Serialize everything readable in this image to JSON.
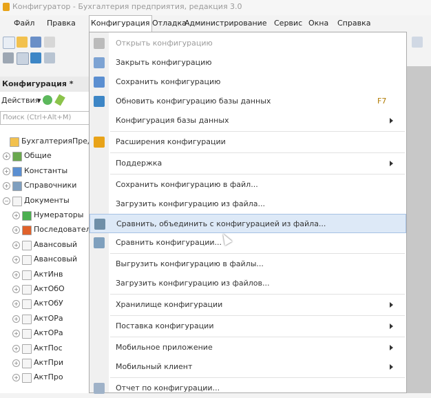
{
  "window": {
    "title": "Конфигуратор - Бухгалтерия предприятия, редакция 3.0"
  },
  "menubar": [
    {
      "label": "Файл",
      "active": false
    },
    {
      "label": "Правка",
      "active": false
    },
    {
      "label": "Конфигурация",
      "active": true
    },
    {
      "label": "Отладка",
      "active": false
    },
    {
      "label": "Администрирование",
      "active": false
    },
    {
      "label": "Сервис",
      "active": false
    },
    {
      "label": "Окна",
      "active": false
    },
    {
      "label": "Справка",
      "active": false
    }
  ],
  "panel": {
    "title": "Конфигурация *",
    "actions_label": "Действия",
    "search_placeholder": "Поиск (Ctrl+Alt+M)",
    "tree": [
      {
        "label": "БухгалтерияПредприятия",
        "level": 0,
        "icon": "root-icon"
      },
      {
        "label": "Общие",
        "level": 1,
        "icon": "common-icon"
      },
      {
        "label": "Константы",
        "level": 1,
        "icon": "constants-icon"
      },
      {
        "label": "Справочники",
        "level": 1,
        "icon": "catalog-icon"
      },
      {
        "label": "Документы",
        "level": 1,
        "icon": "document-icon"
      },
      {
        "label": "Нумераторы",
        "level": 2,
        "icon": "numerator-icon"
      },
      {
        "label": "Последовательности",
        "level": 2,
        "icon": "sequence-icon"
      },
      {
        "label": "Авансовый",
        "level": 2,
        "icon": "document-icon"
      },
      {
        "label": "Авансовый",
        "level": 2,
        "icon": "document-icon"
      },
      {
        "label": "АктИнв",
        "level": 2,
        "icon": "document-icon"
      },
      {
        "label": "АктОбО",
        "level": 2,
        "icon": "document-icon"
      },
      {
        "label": "АктОбУ",
        "level": 2,
        "icon": "document-icon"
      },
      {
        "label": "АктОРа",
        "level": 2,
        "icon": "document-icon"
      },
      {
        "label": "АктОРа",
        "level": 2,
        "icon": "document-icon"
      },
      {
        "label": "АктПос",
        "level": 2,
        "icon": "document-icon"
      },
      {
        "label": "АктПри",
        "level": 2,
        "icon": "document-icon"
      },
      {
        "label": "АктПро",
        "level": 2,
        "icon": "document-icon"
      }
    ]
  },
  "menu": {
    "items": [
      {
        "label": "Открыть конфигурацию",
        "shortcut": "",
        "submenu": false,
        "disabled": true,
        "icon": "open-config-icon"
      },
      {
        "label": "Закрыть конфигурацию",
        "shortcut": "",
        "submenu": false,
        "disabled": false,
        "icon": "close-config-icon"
      },
      {
        "label": "Сохранить конфигурацию",
        "shortcut": "",
        "submenu": false,
        "disabled": false,
        "icon": "save-config-icon"
      },
      {
        "label": "Обновить конфигурацию базы данных",
        "shortcut": "F7",
        "submenu": false,
        "disabled": false,
        "icon": "update-db-icon"
      },
      {
        "label": "Конфигурация базы данных",
        "shortcut": "",
        "submenu": true,
        "disabled": false,
        "icon": ""
      },
      {
        "separator": true
      },
      {
        "label": "Расширения конфигурации",
        "shortcut": "",
        "submenu": false,
        "disabled": false,
        "icon": "extensions-icon"
      },
      {
        "separator": true
      },
      {
        "label": "Поддержка",
        "shortcut": "",
        "submenu": true,
        "disabled": false,
        "icon": ""
      },
      {
        "separator": true
      },
      {
        "label": "Сохранить конфигурацию в файл...",
        "shortcut": "",
        "submenu": false,
        "disabled": false,
        "icon": ""
      },
      {
        "label": "Загрузить конфигурацию из файла...",
        "shortcut": "",
        "submenu": false,
        "disabled": false,
        "icon": ""
      },
      {
        "label": "Сравнить, объединить с конфигурацией из файла...",
        "shortcut": "",
        "submenu": false,
        "disabled": false,
        "icon": "compare-merge-icon",
        "hover": true
      },
      {
        "label": "Сравнить конфигурации...",
        "shortcut": "",
        "submenu": false,
        "disabled": false,
        "icon": "compare-icon"
      },
      {
        "separator": true
      },
      {
        "label": "Выгрузить конфигурацию в файлы...",
        "shortcut": "",
        "submenu": false,
        "disabled": false,
        "icon": ""
      },
      {
        "label": "Загрузить конфигурацию из файлов...",
        "shortcut": "",
        "submenu": false,
        "disabled": false,
        "icon": ""
      },
      {
        "separator": true
      },
      {
        "label": "Хранилище конфигурации",
        "shortcut": "",
        "submenu": true,
        "disabled": false,
        "icon": ""
      },
      {
        "separator": true
      },
      {
        "label": "Поставка конфигурации",
        "shortcut": "",
        "submenu": true,
        "disabled": false,
        "icon": ""
      },
      {
        "separator": true
      },
      {
        "label": "Мобильное приложение",
        "shortcut": "",
        "submenu": true,
        "disabled": false,
        "icon": ""
      },
      {
        "label": "Мобильный клиент",
        "shortcut": "",
        "submenu": true,
        "disabled": false,
        "icon": ""
      },
      {
        "separator": true
      },
      {
        "label": "Отчет по конфигурации...",
        "shortcut": "",
        "submenu": false,
        "disabled": false,
        "icon": "report-icon"
      }
    ]
  },
  "colors": {
    "hover_bg": "#dde9f7",
    "hover_border": "#a6c1e4",
    "shortcut": "#b07a00"
  }
}
